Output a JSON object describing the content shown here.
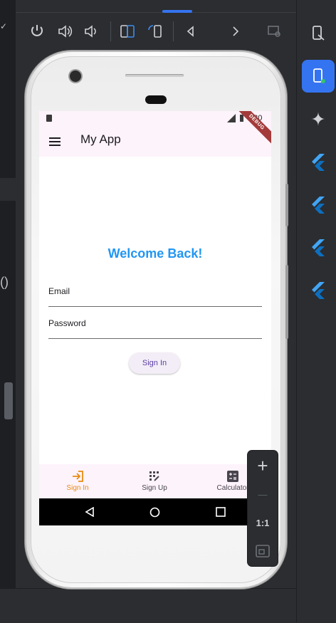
{
  "app": {
    "title": "My App",
    "status_time": "4:30",
    "debug_banner": "DEBUG",
    "welcome": "Welcome Back!",
    "email_label": "Email",
    "password_label": "Password",
    "signin_button": "Sign In"
  },
  "bottom_nav": {
    "items": [
      {
        "label": "Sign In",
        "icon": "login-icon",
        "active": true
      },
      {
        "label": "Sign Up",
        "icon": "app-registration-icon",
        "active": false
      },
      {
        "label": "Calculator",
        "icon": "calculate-icon",
        "active": false
      }
    ]
  },
  "colors": {
    "accent": "#2196f3",
    "active_nav": "#e88b12",
    "inactive_nav": "#49454f",
    "appbar_bg": "#fdf3fb",
    "ide_accent": "#3574f0"
  },
  "zoom": {
    "plus": "+",
    "minus": "—",
    "ratio": "1:1"
  }
}
